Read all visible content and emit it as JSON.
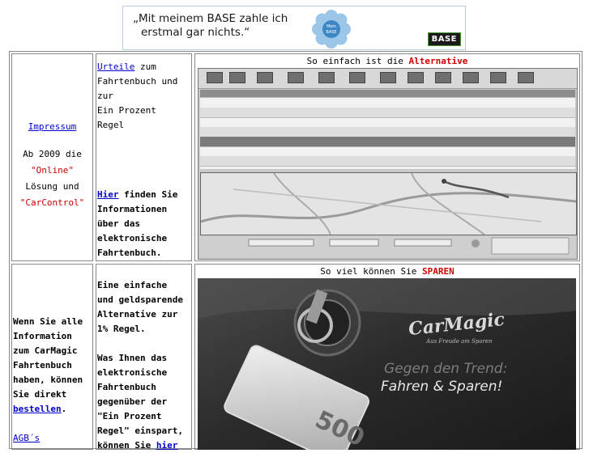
{
  "banner": {
    "line1": "„Mit meinem BASE zahle ich",
    "line2": "erstmal gar nichts.“",
    "badge_line1": "Mein",
    "badge_line2": "BASE",
    "brand": "BASE"
  },
  "left_top": {
    "impressum_link": "Impressum",
    "since_text": "Ab 2009 die",
    "online": "\"Online\"",
    "loesung": "Lösung und",
    "carcontrol": "\"CarControl\""
  },
  "mid_top": {
    "urteile_link": "Urteile",
    "urteile_rest_1": " zum",
    "line2": "Fahrtenbuch und",
    "line3": "zur",
    "line4": "Ein Prozent",
    "line5": "Regel",
    "hier_link": "Hier",
    "hier_rest": " finden Sie",
    "line7": "Informationen",
    "line8": "über das",
    "line9": "elektronische",
    "line10": "Fahrtenbuch."
  },
  "right_top": {
    "heading_prefix": "So einfach ist die ",
    "heading_highlight": "Alternative"
  },
  "left_bottom": {
    "line1": "Wenn Sie alle",
    "line2": "Information",
    "line3": "zum CarMagic",
    "line4": "Fahrtenbuch",
    "line5": "haben, können",
    "line6": "Sie direkt",
    "bestellen_link": "bestellen",
    "period": ".",
    "agb_link": "AGB´s"
  },
  "mid_bottom": {
    "p1": [
      "Eine einfache",
      "und geldsparende",
      "Alternative zur",
      "1% Regel."
    ],
    "p2": [
      "Was Ihnen das",
      "elektronische",
      "Fahrtenbuch",
      "gegenüber der",
      "\"Ein Prozent",
      "Regel\" einspart,"
    ],
    "last_prefix": "können Sie ",
    "last_link": "hier"
  },
  "right_bottom": {
    "heading_prefix": "So viel können Sie ",
    "heading_highlight": "SPAREN",
    "logo": "CarMagic",
    "logo_sub": "Aus Freude am Sparen",
    "tagline1": "Gegen den Trend:",
    "tagline2": "Fahren & Sparen!",
    "banknote": "500"
  },
  "colors": {
    "link": "#0000cc",
    "accent_red": "#cc0000"
  }
}
